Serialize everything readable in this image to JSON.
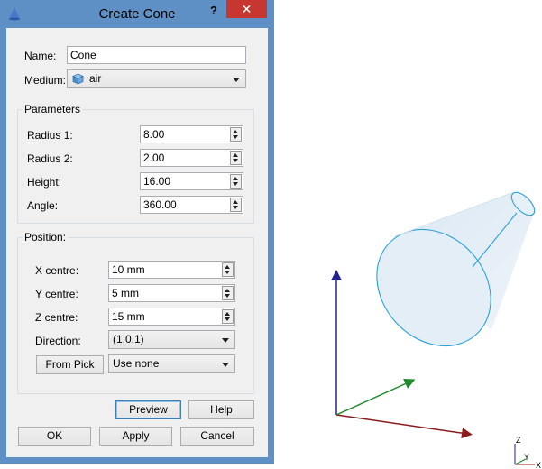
{
  "dialog": {
    "title": "Create Cone",
    "help_label": "?",
    "close_label": "✕",
    "name_label": "Name:",
    "name_value": "Cone",
    "medium_label": "Medium:",
    "medium_value": "air",
    "parameters": {
      "title": "Parameters",
      "radius1_label": "Radius 1:",
      "radius1_value": "8.00",
      "radius2_label": "Radius 2:",
      "radius2_value": "2.00",
      "height_label": "Height:",
      "height_value": "16.00",
      "angle_label": "Angle:",
      "angle_value": "360.00"
    },
    "position": {
      "title": "Position:",
      "x_label": "X centre:",
      "x_value": "10 mm",
      "y_label": "Y centre:",
      "y_value": "5 mm",
      "z_label": "Z centre:",
      "z_value": "15 mm",
      "direction_label": "Direction:",
      "direction_value": "(1,0,1)",
      "from_pick_label": "From Pick",
      "pick_mode_value": "Use none"
    },
    "buttons": {
      "preview": "Preview",
      "help": "Help",
      "ok": "OK",
      "apply": "Apply",
      "cancel": "Cancel"
    }
  },
  "viewport": {
    "axis_labels": {
      "z": "Z",
      "y": "Y",
      "x": "X"
    },
    "colors": {
      "x_axis": "#8b1a1a",
      "y_axis": "#1f8a2a",
      "z_axis": "#22228b",
      "cone_fill": "#e3eef7",
      "cone_edge": "#2aa0d8"
    }
  }
}
